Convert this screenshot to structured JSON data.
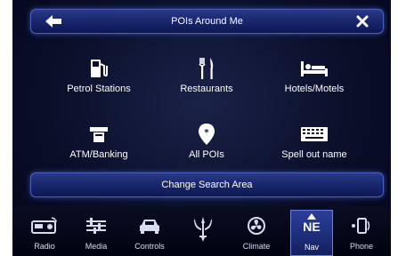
{
  "header": {
    "title": "POIs Around Me",
    "back_icon": "left-arrow-icon",
    "close_icon": "close-x-icon"
  },
  "categories": [
    {
      "label": "Petrol Stations",
      "icon": "fuel-pump-icon"
    },
    {
      "label": "Restaurants",
      "icon": "fork-knife-icon"
    },
    {
      "label": "Hotels/Motels",
      "icon": "bed-icon"
    },
    {
      "label": "ATM/Banking",
      "icon": "atm-icon"
    },
    {
      "label": "All POIs",
      "icon": "map-pin-star-icon"
    },
    {
      "label": "Spell out name",
      "icon": "keyboard-icon"
    }
  ],
  "change_search_area": "Change Search Area",
  "dock": {
    "items": [
      {
        "label": "Radio",
        "icon": "radio-icon"
      },
      {
        "label": "Media",
        "icon": "media-equalizer-icon"
      },
      {
        "label": "Controls",
        "icon": "car-icon"
      },
      {
        "label": "",
        "icon": "maserati-trident-icon"
      },
      {
        "label": "Climate",
        "icon": "climate-fan-icon"
      },
      {
        "label": "Nav",
        "icon": "compass-icon",
        "direction": "NE",
        "active": true
      },
      {
        "label": "Phone",
        "icon": "phone-icon"
      }
    ]
  },
  "colors": {
    "accent": "#2a3a86",
    "border_glow": "#4a5fc0",
    "background": "#0a0f2a",
    "text": "#ffffff"
  }
}
